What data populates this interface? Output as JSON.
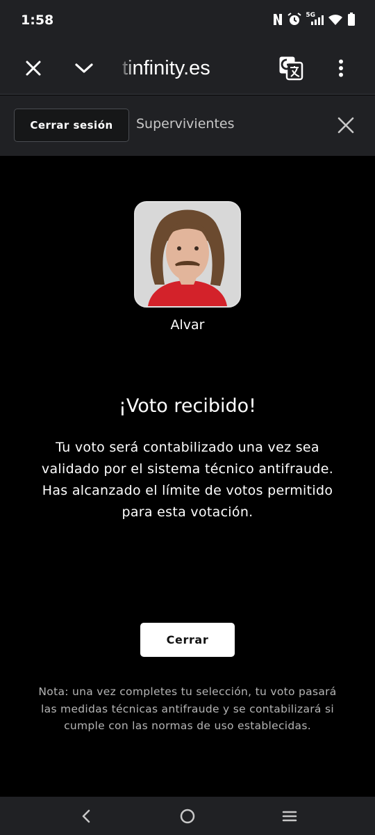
{
  "status_bar": {
    "time": "1:58",
    "network": "5G",
    "icons": [
      "nfc-icon",
      "alarm-icon",
      "signal-icon",
      "wifi-icon",
      "battery-icon"
    ]
  },
  "browser": {
    "url": "tinfinity.es",
    "icons": [
      "close-icon",
      "chevron-down-icon",
      "translate-icon",
      "more-vert-icon"
    ]
  },
  "site_header": {
    "logout_label": "Cerrar sesión",
    "section": "Supervivientes"
  },
  "vote": {
    "candidate_name": "Alvar",
    "title": "¡Voto recibido!",
    "message": "Tu voto será contabilizado una vez sea validado por el sistema técnico antifraude. Has alcanzado el límite de votos permitido para esta votación.",
    "close_label": "Cerrar",
    "note": "Nota: una vez completes tu selección, tu voto pasará las medidas técnicas antifraude y se contabilizará si cumple con las normas de uso establecidas."
  },
  "colors": {
    "background": "#000000",
    "chrome": "#202124",
    "accent_shirt": "#d3222a"
  },
  "nav": {
    "icons": [
      "back-icon",
      "home-icon",
      "recents-icon"
    ]
  }
}
